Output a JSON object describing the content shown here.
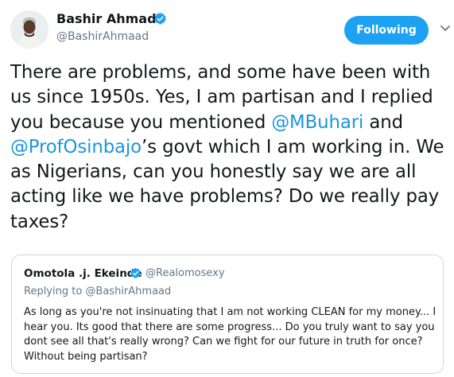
{
  "author": {
    "name": "Bashir Ahmad",
    "handle": "@BashirAhmaad",
    "verified": true
  },
  "follow_button": {
    "label": "Following",
    "color": "#1da1f2"
  },
  "tweet": {
    "text_1": "There are problems, and some have been with us since 1950s. Yes, I am partisan and I replied you because you mentioned ",
    "mention_1": "@MBuhari",
    "text_2": " and ",
    "mention_2": "@ProfOsinbajo",
    "text_3": "’s govt which I am working in. We as Nigerians, can you honestly say we are all acting like we have problems? Do we really pay taxes?"
  },
  "quoted_tweet": {
    "name": "Omotola .j. Ekeinde",
    "handle": "@Realomosexy",
    "replying_to": "Replying to @BashirAhmaad",
    "text": "As long as you're not insinuating that I am not working CLEAN for my money... I hear you. Its good that there are some progress... Do you truly want to say you dont see all that's really wrong? Can we fight for our future in truth for once? Without being partisan?"
  },
  "colors": {
    "link": "#1b95e0",
    "secondary_text": "#657786",
    "border": "#ccd6dd"
  }
}
